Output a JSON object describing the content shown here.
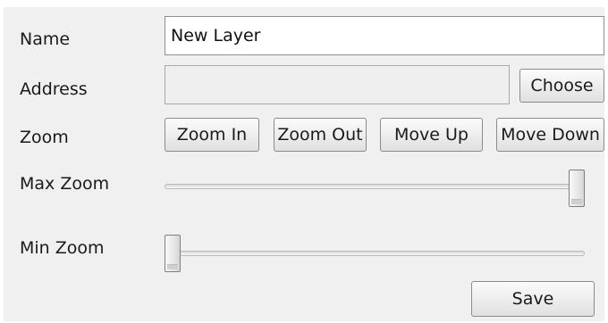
{
  "form": {
    "name": {
      "label": "Name",
      "value": "New Layer"
    },
    "address": {
      "label": "Address",
      "value": "",
      "choose_label": "Choose"
    },
    "zoom": {
      "label": "Zoom",
      "buttons": [
        "Zoom In",
        "Zoom Out",
        "Move Up",
        "Move Down"
      ]
    },
    "max_zoom": {
      "label": "Max Zoom",
      "level": 1.0
    },
    "min_zoom": {
      "label": "Min Zoom",
      "level": 0.0
    },
    "save_label": "Save"
  }
}
